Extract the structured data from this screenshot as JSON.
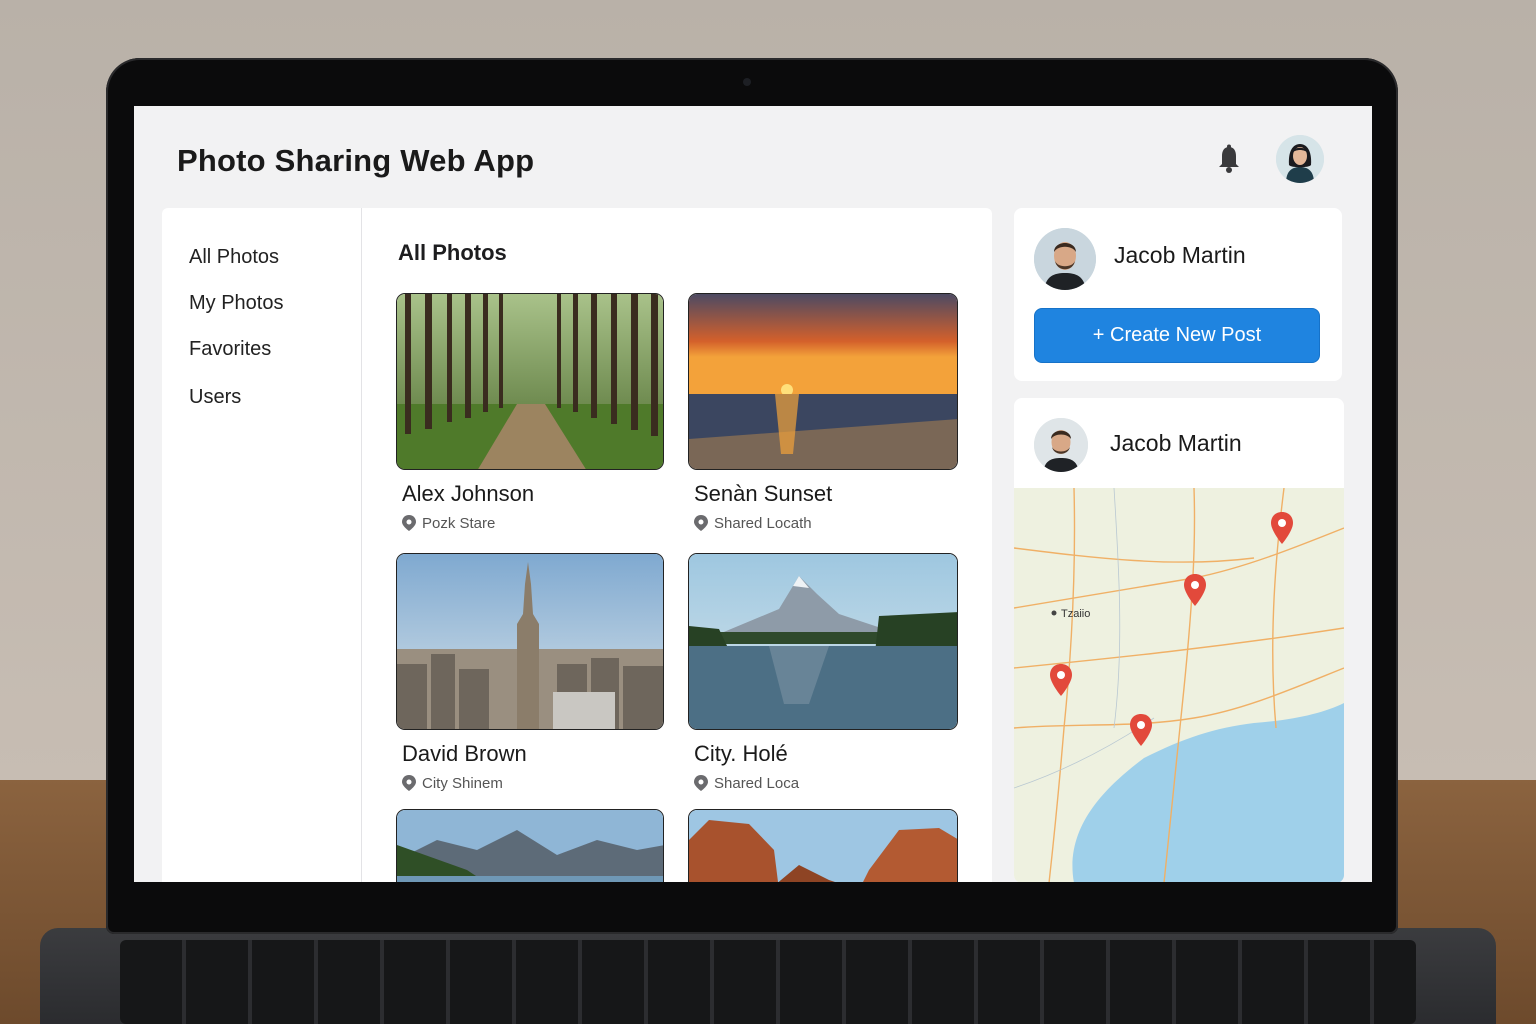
{
  "app": {
    "title": "Photo Sharing Web App"
  },
  "header": {
    "bell_icon": "bell-icon",
    "avatar_icon": "user-avatar"
  },
  "sidebar": {
    "items": [
      {
        "label": "All Photos"
      },
      {
        "label": "My Photos"
      },
      {
        "label": "Favorites"
      },
      {
        "label": "Users"
      }
    ]
  },
  "main": {
    "title": "All Photos",
    "photos": [
      {
        "title": "Alex Johnson",
        "location": "Pozk Stare",
        "scene": "forest-path"
      },
      {
        "title": "Senàn Sunset",
        "location": "Shared Locath",
        "scene": "ocean-sunset"
      },
      {
        "title": "David Brown",
        "location": "City Shinem",
        "scene": "city-skyline"
      },
      {
        "title": "City. Holé",
        "location": "Shared Loca",
        "scene": "mountain-lake"
      },
      {
        "title": "",
        "location": "",
        "scene": "mountain-valley"
      },
      {
        "title": "",
        "location": "",
        "scene": "red-rocks"
      }
    ]
  },
  "profile": {
    "name": "Jacob Martin",
    "create_button": "+ Create New Post"
  },
  "map_panel": {
    "name": "Jacob Martin",
    "map_label": "Tzaiio"
  },
  "colors": {
    "accent": "#1f84e0",
    "pin": "#e2493b",
    "water": "#9fd0ea",
    "land": "#eef1e0"
  }
}
